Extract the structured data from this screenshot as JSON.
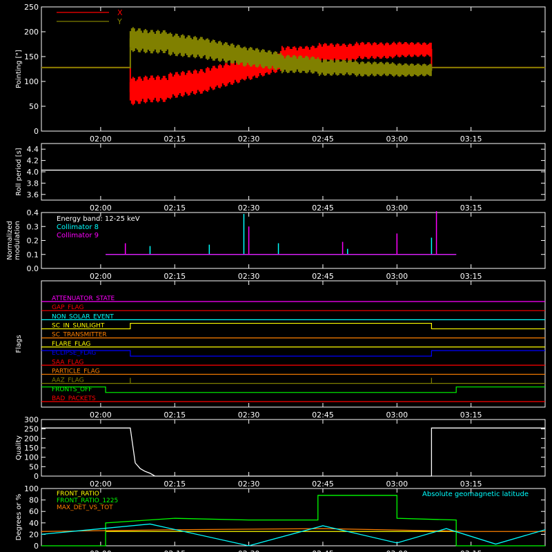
{
  "chart_data": [
    {
      "type": "line",
      "ylabel": "Pointing [\"]",
      "ylim": [
        0,
        250
      ],
      "yticks": [
        "0",
        "50",
        "100",
        "150",
        "200",
        "250"
      ],
      "xlim": [
        "01:48",
        "03:30"
      ],
      "xticks": [
        "02:00",
        "02:15",
        "02:30",
        "02:45",
        "03:00",
        "03:15"
      ],
      "legend": "top-left",
      "series": [
        {
          "name": "X",
          "color": "#ff0000",
          "x": [
            "01:48",
            "02:06",
            "02:06",
            "02:10",
            "02:20",
            "02:30",
            "02:40",
            "02:50",
            "03:00",
            "03:07",
            "03:07",
            "03:30"
          ],
          "y": [
            128,
            128,
            80,
            85,
            100,
            125,
            150,
            158,
            162,
            164,
            128,
            128
          ]
        },
        {
          "name": "Y",
          "color": "#808000",
          "x": [
            "01:48",
            "02:06",
            "02:06",
            "02:10",
            "02:20",
            "02:30",
            "02:40",
            "02:50",
            "03:00",
            "03:07",
            "03:07",
            "03:30"
          ],
          "y": [
            128,
            128,
            185,
            180,
            168,
            150,
            135,
            128,
            125,
            123,
            128,
            128
          ]
        }
      ]
    },
    {
      "type": "line",
      "ylabel": "Roll period [s]",
      "ylim": [
        3.5,
        4.5
      ],
      "yticks": [
        "3.6",
        "3.8",
        "4.0",
        "4.2",
        "4.4"
      ],
      "xlim": [
        "01:48",
        "03:30"
      ],
      "xticks": [
        "02:00",
        "02:15",
        "02:30",
        "02:45",
        "03:00",
        "03:15"
      ],
      "series": [
        {
          "color": "#ffffff",
          "x": [
            "01:48",
            "03:30"
          ],
          "y": [
            4.03,
            4.03
          ]
        }
      ]
    },
    {
      "type": "line",
      "ylabel": "Normalized modulation",
      "ylim": [
        0,
        0.4
      ],
      "yticks": [
        "0.0",
        "0.1",
        "0.2",
        "0.3",
        "0.4"
      ],
      "xlim": [
        "01:48",
        "03:30"
      ],
      "xticks": [
        "02:00",
        "02:15",
        "02:30",
        "02:45",
        "03:00",
        "03:15"
      ],
      "annotation": "Energy band: 12-25 keV",
      "legend": "top-left",
      "series": [
        {
          "name": "Collimator 8",
          "color": "#00ffff",
          "x": [
            "02:01",
            "03:12"
          ],
          "y": [
            0.1,
            0.1
          ],
          "spikes": [
            [
              "02:10",
              0.16
            ],
            [
              "02:22",
              0.17
            ],
            [
              "02:29",
              0.39
            ],
            [
              "02:36",
              0.18
            ],
            [
              "02:50",
              0.14
            ],
            [
              "03:07",
              0.22
            ]
          ]
        },
        {
          "name": "Collimator 9",
          "color": "#ff00ff",
          "x": [
            "02:01",
            "03:12"
          ],
          "y": [
            0.1,
            0.1
          ],
          "spikes": [
            [
              "02:05",
              0.18
            ],
            [
              "02:30",
              0.3
            ],
            [
              "02:49",
              0.19
            ],
            [
              "03:00",
              0.25
            ],
            [
              "03:08",
              0.41
            ]
          ]
        }
      ]
    },
    {
      "type": "line",
      "ylabel": "Flags",
      "xlim": [
        "01:48",
        "03:30"
      ],
      "xticks": [
        "02:00",
        "02:15",
        "02:30",
        "02:45",
        "03:00",
        "03:15"
      ],
      "series": [
        {
          "name": "ATTENUATOR_STATE",
          "color": "#ff00ff",
          "x": [
            "01:48",
            "03:30"
          ],
          "y": [
            0,
            0
          ]
        },
        {
          "name": "GAP_FLAG",
          "color": "#ff0000",
          "x": [
            "01:48",
            "03:30"
          ],
          "y": [
            0,
            0
          ]
        },
        {
          "name": "NON_SOLAR_EVENT",
          "color": "#00ffff",
          "x": [
            "01:48",
            "03:30"
          ],
          "y": [
            0,
            0
          ]
        },
        {
          "name": "SC_IN_SUNLIGHT",
          "color": "#ffff00",
          "x": [
            "01:48",
            "02:06",
            "02:06",
            "03:07",
            "03:07",
            "03:30"
          ],
          "y": [
            0,
            0,
            1,
            1,
            0,
            0
          ]
        },
        {
          "name": "SC_TRANSMITTER",
          "color": "#ff8000",
          "x": [
            "01:48",
            "03:30"
          ],
          "y": [
            0,
            0
          ]
        },
        {
          "name": "FLARE_FLAG",
          "color": "#ffff00",
          "x": [
            "01:48",
            "03:30"
          ],
          "y": [
            0,
            0
          ]
        },
        {
          "name": "ECLIPSE_FLAG",
          "color": "#0000ff",
          "x": [
            "01:48",
            "02:06",
            "02:06",
            "03:07",
            "03:07",
            "03:30"
          ],
          "y": [
            1,
            1,
            0,
            0,
            1,
            1
          ]
        },
        {
          "name": "SAA_FLAG",
          "color": "#ff0000",
          "x": [
            "01:48",
            "03:30"
          ],
          "y": [
            0,
            0
          ]
        },
        {
          "name": "PARTICLE_FLAG",
          "color": "#ff8000",
          "x": [
            "01:48",
            "03:30"
          ],
          "y": [
            0,
            0
          ]
        },
        {
          "name": "AAZ_FLAG",
          "color": "#808000",
          "x": [
            "01:48",
            "02:06",
            "02:06",
            "02:06",
            "02:06",
            "03:07",
            "03:07",
            "03:07",
            "03:07",
            "03:30"
          ],
          "y": [
            0,
            0,
            1,
            1,
            0,
            0,
            1,
            1,
            0,
            0
          ]
        },
        {
          "name": "FRONTS_OFF",
          "color": "#00ff00",
          "x": [
            "01:48",
            "02:01",
            "02:01",
            "03:12",
            "03:12",
            "03:30"
          ],
          "y": [
            1,
            1,
            0,
            0,
            1,
            1
          ]
        },
        {
          "name": "BAD_PACKETS",
          "color": "#ff0000",
          "x": [
            "01:48",
            "03:30"
          ],
          "y": [
            0,
            0
          ]
        }
      ]
    },
    {
      "type": "line",
      "ylabel": "Quality",
      "ylim": [
        0,
        300
      ],
      "yticks": [
        "0",
        "50",
        "100",
        "150",
        "200",
        "250",
        "300"
      ],
      "xlim": [
        "01:48",
        "03:30"
      ],
      "xticks": [
        "02:00",
        "02:15",
        "02:30",
        "02:45",
        "03:00",
        "03:15"
      ],
      "series": [
        {
          "color": "#ffffff",
          "x": [
            "01:48",
            "02:01",
            "02:01",
            "02:06",
            "02:07",
            "02:08",
            "02:09",
            "02:10",
            "02:11",
            "03:07",
            "03:07",
            "03:30"
          ],
          "y": [
            255,
            255,
            255,
            255,
            70,
            40,
            25,
            15,
            0,
            0,
            255,
            255
          ]
        }
      ]
    },
    {
      "type": "line",
      "ylabel": "Degrees or %",
      "ylim": [
        0,
        100
      ],
      "yticks": [
        "0",
        "20",
        "40",
        "60",
        "80",
        "100"
      ],
      "xlim": [
        "01:48",
        "03:30"
      ],
      "xticks": [
        "02:00",
        "02:15",
        "02:30",
        "02:45",
        "03:00",
        "03:15"
      ],
      "annotation": "Absolute geomagnetic latitude",
      "legend": "top-left",
      "series": [
        {
          "name": "FRONT_RATIO",
          "color": "#ffff00",
          "x": [
            "02:01",
            "03:12"
          ],
          "y": [
            25,
            25
          ]
        },
        {
          "name": "FRONT_RATIO_1225",
          "color": "#00ff00",
          "x": [
            "01:48",
            "02:01",
            "02:01",
            "02:15",
            "02:30",
            "02:44",
            "02:44",
            "03:00",
            "03:00",
            "03:12",
            "03:12",
            "03:30"
          ],
          "y": [
            0,
            0,
            40,
            48,
            45,
            45,
            88,
            88,
            48,
            45,
            0,
            0
          ]
        },
        {
          "name": "MAX_DET_VS_TOT",
          "color": "#ff8000",
          "x": [
            "01:48",
            "02:15",
            "02:45",
            "03:15",
            "03:30"
          ],
          "y": [
            25,
            28,
            30,
            25,
            25
          ]
        },
        {
          "name": "Absolute geomagnetic latitude",
          "color": "#00ffff",
          "x": [
            "01:48",
            "02:10",
            "02:30",
            "02:45",
            "03:00",
            "03:10",
            "03:20",
            "03:30"
          ],
          "y": [
            20,
            38,
            0,
            35,
            5,
            30,
            3,
            28
          ]
        }
      ]
    }
  ]
}
